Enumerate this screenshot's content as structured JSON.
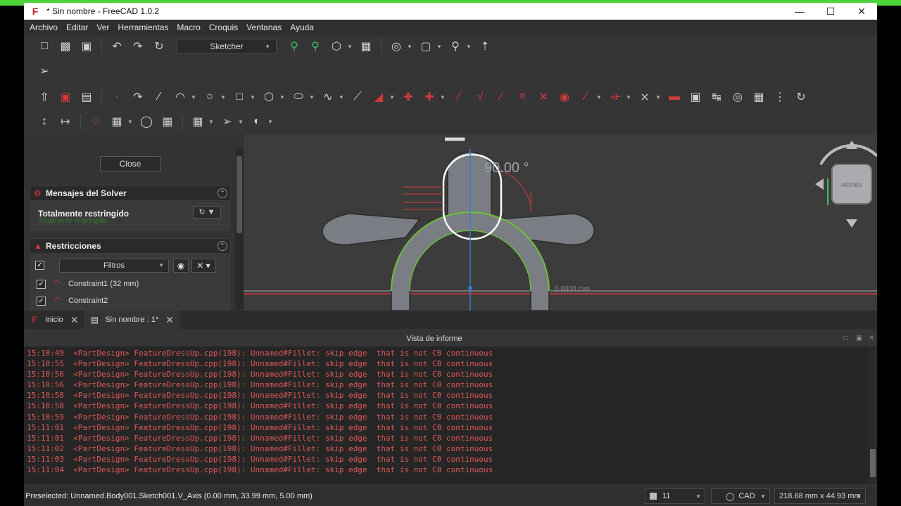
{
  "window": {
    "title": "* Sin nombre - FreeCAD 1.0.2",
    "app_icon": "freecad-icon",
    "controls": {
      "minimize": "—",
      "maximize": "☐",
      "close": "✕"
    }
  },
  "menu": [
    "Archivo",
    "Editar",
    "Ver",
    "Herramientas",
    "Macro",
    "Croquis",
    "Ventanas",
    "Ayuda"
  ],
  "toolbar1": {
    "workbench": "Sketcher",
    "icons": [
      "new-document-icon",
      "open-icon",
      "save-icon",
      "undo-icon",
      "redo-icon",
      "refresh-icon",
      "fit-all-icon",
      "fit-selection-icon",
      "isometric-view-icon",
      "draw-style-icon",
      "stereo-icon",
      "std-view-icon",
      "measure-icon",
      "whats-this-icon"
    ]
  },
  "toolbar2": {
    "icons": [
      "select-arrow-icon"
    ]
  },
  "left_panel": {
    "close_label": "Close",
    "solver_title": "Mensajes del Solver",
    "solver_status": "Totalmente restringido",
    "solver_status_echo": "Totalmente restringido",
    "constraints_title": "Restricciones",
    "filters_label": "Filtros",
    "constraints": [
      {
        "label": "Constraint1 (32 mm)",
        "checked": true
      },
      {
        "label": "Constraint2",
        "checked": true
      }
    ]
  },
  "view3d": {
    "angle_label": "90.00 °",
    "axis_label": "0.0000 mm",
    "navcube_face": "ARRIBA",
    "top_label": "▄▄▄▄▄"
  },
  "tabs": [
    {
      "label": "Inicio",
      "icon": "freecad-start-icon"
    },
    {
      "label": "Sin nombre : 1*",
      "icon": "document-icon"
    }
  ],
  "report": {
    "title": "Vista de informe",
    "lines": [
      "15:10:49  <PartDesign> FeatureDressUp.cpp(198): Unnamed#Fillet: skip edge  that is not C0 continuous",
      "15:10:55  <PartDesign> FeatureDressUp.cpp(198): Unnamed#Fillet: skip edge  that is not C0 continuous",
      "15:10:56  <PartDesign> FeatureDressUp.cpp(198): Unnamed#Fillet: skip edge  that is not C0 continuous",
      "15:10:56  <PartDesign> FeatureDressUp.cpp(198): Unnamed#Fillet: skip edge  that is not C0 continuous",
      "15:10:58  <PartDesign> FeatureDressUp.cpp(198): Unnamed#Fillet: skip edge  that is not C0 continuous",
      "15:10:58  <PartDesign> FeatureDressUp.cpp(198): Unnamed#Fillet: skip edge  that is not C0 continuous",
      "15:10:59  <PartDesign> FeatureDressUp.cpp(198): Unnamed#Fillet: skip edge  that is not C0 continuous",
      "15:11:01  <PartDesign> FeatureDressUp.cpp(198): Unnamed#Fillet: skip edge  that is not C0 continuous",
      "15:11:01  <PartDesign> FeatureDressUp.cpp(198): Unnamed#Fillet: skip edge  that is not C0 continuous",
      "15:11:02  <PartDesign> FeatureDressUp.cpp(198): Unnamed#Fillet: skip edge  that is not C0 continuous",
      "15:11:03  <PartDesign> FeatureDressUp.cpp(198): Unnamed#Fillet: skip edge  that is not C0 continuous",
      "15:11:04  <PartDesign> FeatureDressUp.cpp(198): Unnamed#Fillet: skip edge  that is not C0 continuous"
    ]
  },
  "status": {
    "text": "Preselected: Unnamed.Body001.Sketch001.V_Axis (0.00 mm, 33.99 mm, 5.00 mm)",
    "layer_count": "11",
    "nav_style": "CAD",
    "dimensions": "218.68 mm x 44.93 mm"
  },
  "colors": {
    "accent_red": "#d23a3a",
    "accent_green": "#3fbf5a",
    "title_green": "#4cd23a"
  }
}
